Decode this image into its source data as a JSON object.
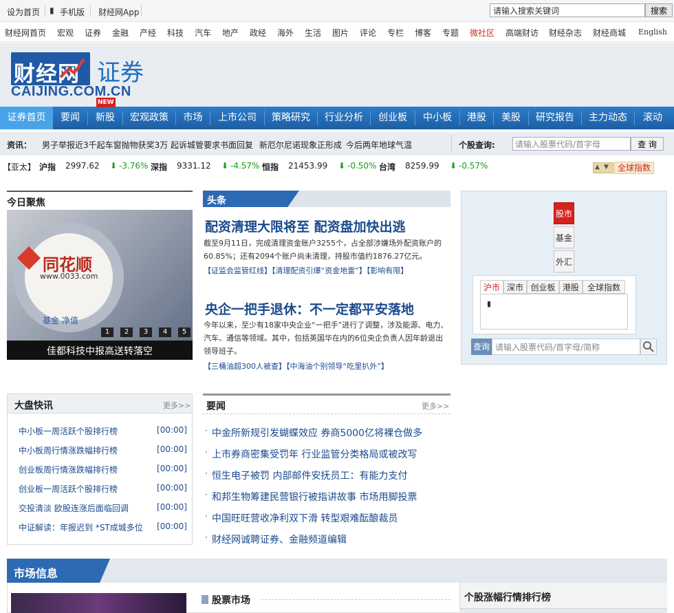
{
  "top_bar": {
    "set_home": "设为首页",
    "mobile": "手机版",
    "app": "财经网App",
    "search_placeholder": "请输入搜索关键词",
    "search_button": "搜索"
  },
  "channel_nav": [
    "财经网首页",
    "宏观",
    "证券",
    "金融",
    "产经",
    "科技",
    "汽车",
    "地产",
    "政经",
    "海外",
    "生活",
    "图片",
    "评论",
    "专栏",
    "博客",
    "专题",
    "微社区",
    "高端财访",
    "财经杂志",
    "财经商城",
    "English"
  ],
  "header": {
    "logo_cn": "财经网",
    "logo_en": "CAIJING.COM.CN",
    "channel": "证券"
  },
  "main_nav": {
    "items": [
      "证券首页",
      "要闻",
      "新股",
      "宏观政策",
      "市场",
      "上市公司",
      "策略研究",
      "行业分析",
      "创业板",
      "中小板",
      "港股",
      "美股",
      "研究报告",
      "主力动态",
      "滚动"
    ],
    "new_badge": "NEW"
  },
  "news_strip": {
    "label": "资讯：",
    "items": [
      "男子举报近3千起车窗抛物获奖3万",
      "起诉城管要求书面回复",
      "新厄尔尼诺现象正形成",
      "今后两年地球气温"
    ],
    "stock_query_label": "个股查询:",
    "stock_placeholder": "请输入股票代码/首字母",
    "query_button": "查 询"
  },
  "ticker": {
    "region": "【亚太】",
    "indices": [
      {
        "name": "沪指",
        "value": "2997.62",
        "change": "-3.76%"
      },
      {
        "name": "深指",
        "value": "9331.12",
        "change": "-4.57%"
      },
      {
        "name": "恒指",
        "value": "21453.99",
        "change": "-0.50%"
      },
      {
        "name": "台湾",
        "value": "8259.99",
        "change": "-0.57%"
      }
    ],
    "global_button": "全球指数"
  },
  "focus": {
    "title": "今日聚焦",
    "caption": "佳都科技中报高送转落空",
    "pages": [
      "1",
      "2",
      "3",
      "4",
      "5"
    ],
    "image_text_brand": "同花顺",
    "image_text_url": "www.0033.com",
    "image_text_bottom": "基金  净值"
  },
  "headlines": {
    "title": "头条",
    "story1": {
      "headline": "配资清理大限将至 配资盘加快出逃",
      "body": "截至9月11日，完成清理资金账户3255个，占全部涉嫌场外配资账户的60.85%；还有2094个账户尚未清理，持股市值约1876.27亿元。",
      "links": "【证监会监管红线】【清理配资引爆“资金地雷”】【影响有限】"
    },
    "story2": {
      "headline": "央企一把手退休：不一定都平安落地",
      "body": "今年以来，至少有18家中央企业“一把手”进行了调整，涉及能源、电力、汽车、通信等领域。其中，包括英国华在内的6位央企负责人因年龄退出领导班子。",
      "links": "【三桶油超300人被查】【中海油个别领导“吃里扒外”】"
    }
  },
  "market_widget": {
    "side_tabs": [
      "股市",
      "基金",
      "外汇"
    ],
    "tabs": [
      "沪市",
      "深市",
      "创业板",
      "港股",
      "全球指数"
    ],
    "query_label": "查询",
    "placeholder": "请输入股票代码/首字母/简称"
  },
  "quick_news": {
    "title": "大盘快讯",
    "more": "更多>>",
    "items": [
      {
        "text": "中小板一周活跃个股排行榜",
        "time": "[00:00]"
      },
      {
        "text": "中小板周行情涨跌幅排行榜",
        "time": "[00:00]"
      },
      {
        "text": "创业板周行情涨跌幅排行榜",
        "time": "[00:00]"
      },
      {
        "text": "创业板一周活跃个股排行榜",
        "time": "[00:00]"
      },
      {
        "text": "交投清淡  欧股连涨后面临回调",
        "time": "[00:00]"
      },
      {
        "text": "中证解读：年报迟到 *ST成城多位",
        "time": "[00:00]"
      }
    ]
  },
  "key_news": {
    "title": "要闻",
    "more": "更多>>",
    "items": [
      "中金所新规引发蝴蝶效应 券商5000亿将裸仓做多",
      "上市券商密集受罚年 行业监管分类格局或被改写",
      "恒生电子被罚 内部邮件安抚员工：有能力支付",
      "和邦生物筹建民营银行被指讲故事 市场用脚投票",
      "中国旺旺营收净利双下滑 转型艰难酝酿裁员",
      "财经网诚聘证券、金融频道编辑"
    ]
  },
  "market_info": {
    "title": "市场信息",
    "stock_market": "股票市场",
    "ranking_title": "个股涨幅行情排行榜"
  }
}
